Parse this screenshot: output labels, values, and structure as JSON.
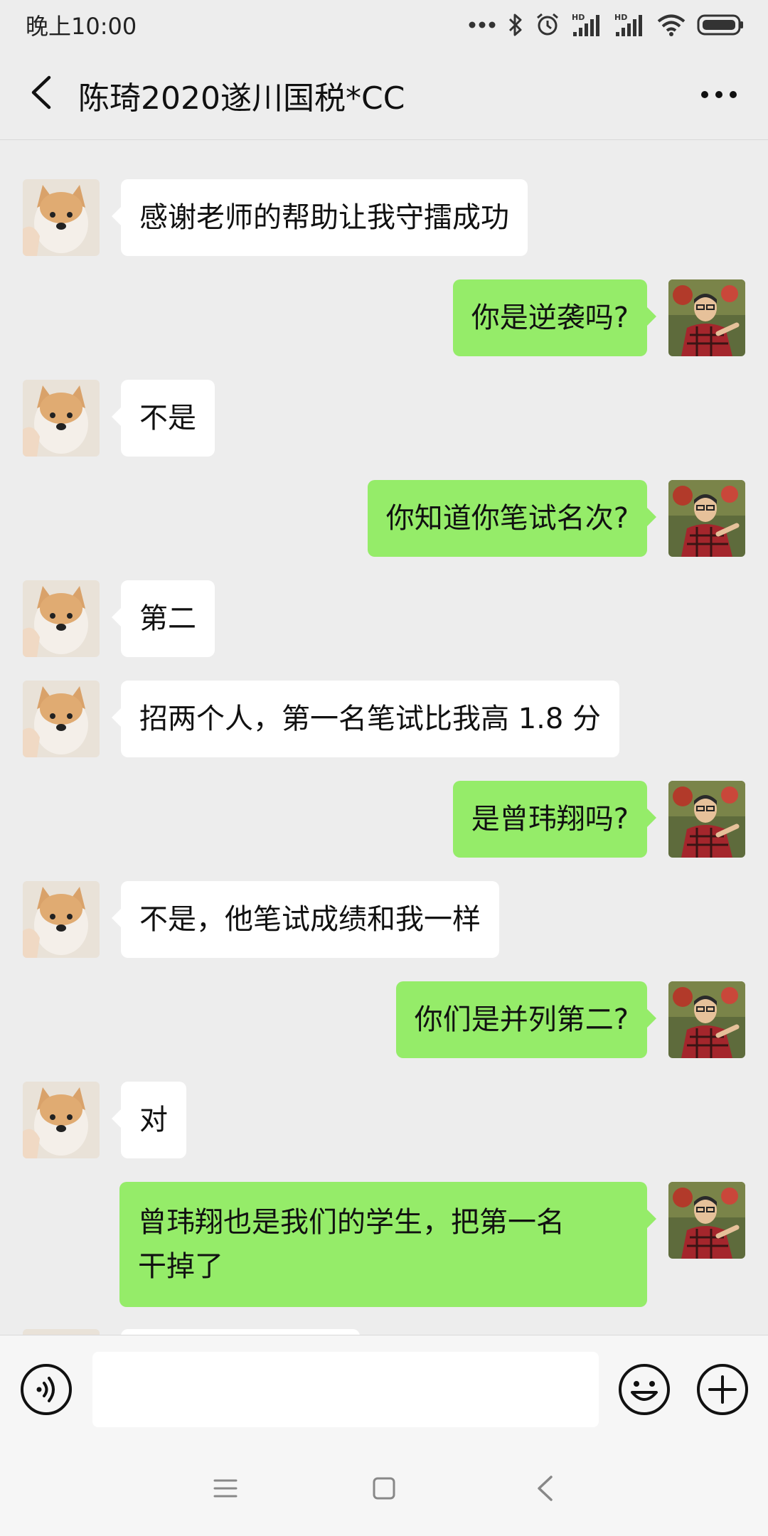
{
  "status_bar": {
    "time": "晚上10:00",
    "icons": [
      "more-dots-icon",
      "bluetooth-icon",
      "alarm-icon",
      "hd-signal-icon",
      "hd-signal-icon",
      "wifi-icon",
      "battery-icon"
    ],
    "hd_label": "HD"
  },
  "header": {
    "title": "陈琦2020遂川国税*CC",
    "back_icon": "chevron-left-icon",
    "more_icon": "more-horizontal-icon"
  },
  "messages": [
    {
      "side": "left",
      "text": "感谢老师的帮助让我守擂成功"
    },
    {
      "side": "right",
      "text": "你是逆袭吗?"
    },
    {
      "side": "left",
      "text": "不是"
    },
    {
      "side": "right",
      "text": "你知道你笔试名次?"
    },
    {
      "side": "left",
      "text": "第二"
    },
    {
      "side": "left",
      "text": "招两个人，第一名笔试比我高 1.8 分"
    },
    {
      "side": "right",
      "text": "是曾玮翔吗?"
    },
    {
      "side": "left",
      "text": "不是，他笔试成绩和我一样"
    },
    {
      "side": "right",
      "text": "你们是并列第二?"
    },
    {
      "side": "left",
      "text": "对"
    },
    {
      "side": "right",
      "text": "曾玮翔也是我们的学生，把第一名\n干掉了"
    }
  ],
  "input_bar": {
    "placeholder": "",
    "voice_icon": "voice-icon",
    "emoji_icon": "emoji-icon",
    "plus_icon": "plus-icon"
  },
  "nav_bar": {
    "icons": [
      "menu-icon",
      "home-square-icon",
      "back-triangle-icon"
    ]
  },
  "colors": {
    "background": "#ededed",
    "sent_bubble": "#95ec69",
    "received_bubble": "#ffffff"
  }
}
